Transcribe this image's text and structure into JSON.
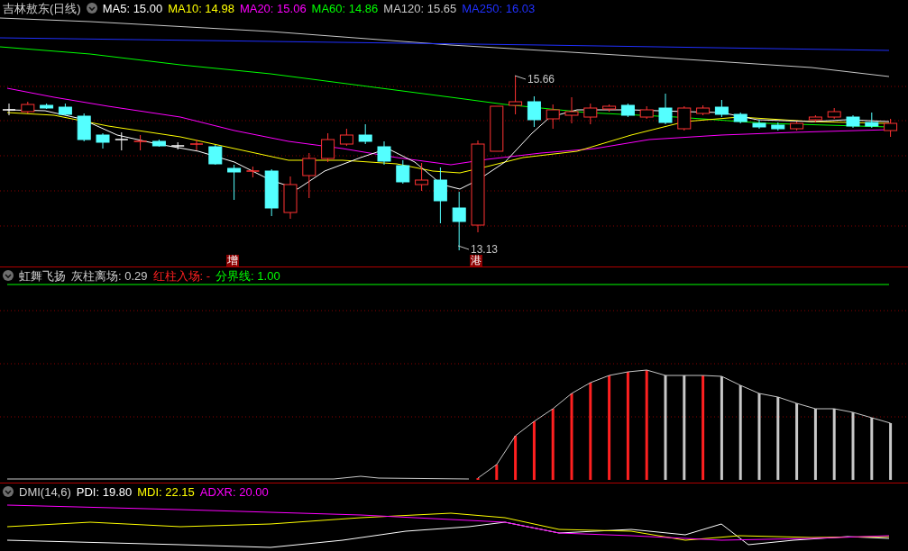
{
  "main_panel": {
    "title": "吉林敖东(日线)",
    "legend": [
      {
        "text": "MA5: 15.00",
        "color": "#ffffff"
      },
      {
        "text": "MA10: 14.98",
        "color": "#ffff00"
      },
      {
        "text": "MA20: 15.06",
        "color": "#ff00ff"
      },
      {
        "text": "MA60: 14.86",
        "color": "#00ff00"
      },
      {
        "text": "MA120: 15.65",
        "color": "#c8c8c8"
      },
      {
        "text": "MA250: 16.03",
        "color": "#2030ff"
      }
    ],
    "price_labels": [
      {
        "text": "15.66",
        "kind": "high"
      },
      {
        "text": "13.13",
        "kind": "low"
      }
    ],
    "event_tags": [
      "增",
      "港"
    ]
  },
  "indicator_panel": {
    "title": "虹舞飞扬",
    "legend": [
      {
        "text": "灰柱离场: 0.29",
        "color": "#c8c8c8"
      },
      {
        "text": "红柱入场: -",
        "color": "#ff2020"
      },
      {
        "text": "分界线: 1.00",
        "color": "#00ff00"
      }
    ]
  },
  "dmi_panel": {
    "title": "DMI(14,6)",
    "legend": [
      {
        "text": "PDI: 19.80",
        "color": "#ffffff"
      },
      {
        "text": "MDI: 22.15",
        "color": "#ffff00"
      },
      {
        "text": "ADXR: 20.00",
        "color": "#ff00ff"
      }
    ]
  }
}
